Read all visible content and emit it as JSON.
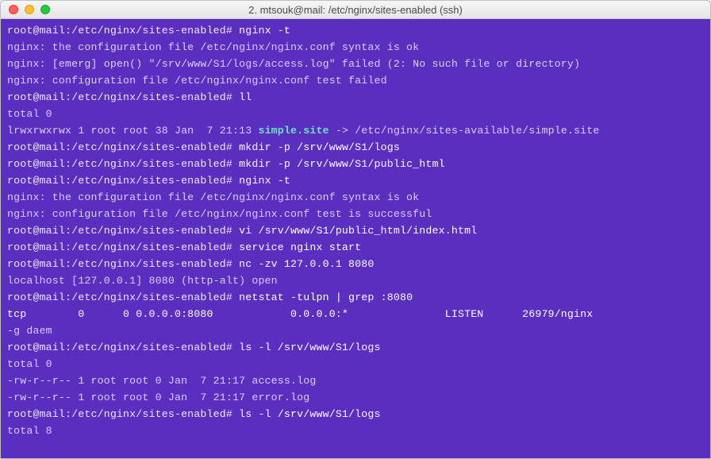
{
  "window": {
    "title": "2. mtsouk@mail: /etc/nginx/sites-enabled (ssh)"
  },
  "prompt": "root@mail:/etc/nginx/sites-enabled#",
  "lines": [
    {
      "t": "cmd",
      "text": "nginx -t"
    },
    {
      "t": "out",
      "text": "nginx: the configuration file /etc/nginx/nginx.conf syntax is ok"
    },
    {
      "t": "out",
      "text": "nginx: [emerg] open() \"/srv/www/S1/logs/access.log\" failed (2: No such file or directory)"
    },
    {
      "t": "out",
      "text": "nginx: configuration file /etc/nginx/nginx.conf test failed"
    },
    {
      "t": "cmd",
      "text": "ll"
    },
    {
      "t": "out",
      "text": "total 0"
    },
    {
      "t": "link",
      "pre": "lrwxrwxrwx 1 root root 38 Jan  7 21:13 ",
      "hi": "simple.site",
      "post": " -> /etc/nginx/sites-available/simple.site"
    },
    {
      "t": "cmd",
      "text": "mkdir -p /srv/www/S1/logs"
    },
    {
      "t": "cmd",
      "text": "mkdir -p /srv/www/S1/public_html"
    },
    {
      "t": "cmd",
      "text": "nginx -t"
    },
    {
      "t": "out",
      "text": "nginx: the configuration file /etc/nginx/nginx.conf syntax is ok"
    },
    {
      "t": "out",
      "text": "nginx: configuration file /etc/nginx/nginx.conf test is successful"
    },
    {
      "t": "cmd",
      "text": "vi /srv/www/S1/public_html/index.html"
    },
    {
      "t": "cmd",
      "text": "service nginx start"
    },
    {
      "t": "cmd",
      "text": "nc -zv 127.0.0.1 8080"
    },
    {
      "t": "out",
      "text": "localhost [127.0.0.1] 8080 (http-alt) open"
    },
    {
      "t": "cmd",
      "text": "netstat -tulpn | grep :8080"
    },
    {
      "t": "net",
      "text": "tcp        0      0 0.0.0.0:8080            0.0.0.0:*               LISTEN      26979/nginx "
    },
    {
      "t": "out",
      "text": "-g daem"
    },
    {
      "t": "cmd",
      "text": "ls -l /srv/www/S1/logs"
    },
    {
      "t": "out",
      "text": "total 0"
    },
    {
      "t": "out",
      "text": "-rw-r--r-- 1 root root 0 Jan  7 21:17 access.log"
    },
    {
      "t": "out",
      "text": "-rw-r--r-- 1 root root 0 Jan  7 21:17 error.log"
    },
    {
      "t": "cmd",
      "text": "ls -l /srv/www/S1/logs"
    },
    {
      "t": "out",
      "text": "total 8"
    }
  ]
}
